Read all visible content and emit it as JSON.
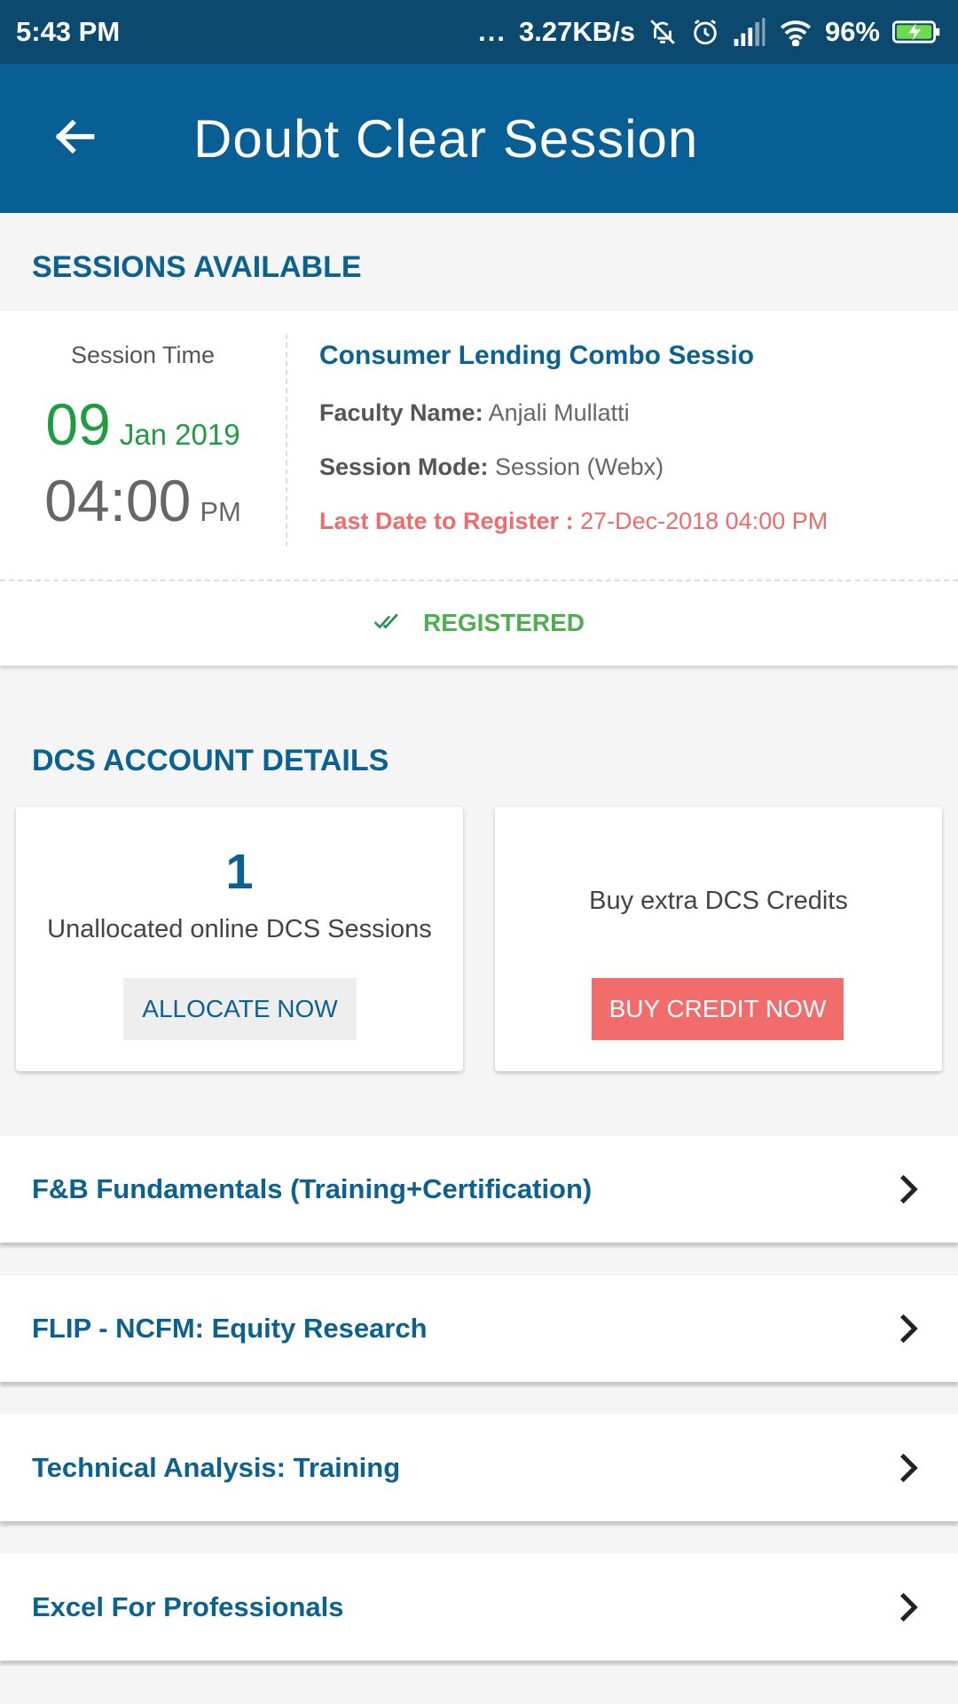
{
  "status_bar": {
    "time": "5:43 PM",
    "dots": "...",
    "speed": "3.27KB/s",
    "battery": "96%",
    "icons": [
      "bell-off-icon",
      "alarm-icon",
      "signal-icon",
      "wifi-icon",
      "battery-charging-icon"
    ]
  },
  "app_bar": {
    "title": "Doubt Clear Session",
    "back_icon": "arrow-left-icon"
  },
  "sessions": {
    "header": "SESSIONS AVAILABLE",
    "card": {
      "time_label": "Session Time",
      "day": "09",
      "month_year": "Jan 2019",
      "time": "04:00",
      "ampm": "PM",
      "title": "Consumer Lending Combo Sessio",
      "faculty_label": "Faculty Name:",
      "faculty_value": "Anjali Mullatti",
      "mode_label": "Session Mode:",
      "mode_value": "Session (Webx)",
      "deadline_label": "Last Date to Register :",
      "deadline_value": "27-Dec-2018 04:00 PM",
      "status": "REGISTERED",
      "status_icon": "double-check-icon"
    }
  },
  "dcs": {
    "header": "DCS ACCOUNT DETAILS",
    "allocate_card": {
      "count": "1",
      "text": "Unallocated online DCS Sessions",
      "button": "ALLOCATE NOW"
    },
    "buy_card": {
      "text": "Buy extra DCS Credits",
      "button": "BUY CREDIT NOW"
    }
  },
  "courses": [
    {
      "name": "F&B Fundamentals (Training+Certification)"
    },
    {
      "name": "FLIP - NCFM: Equity Research"
    },
    {
      "name": "Technical Analysis: Training"
    },
    {
      "name": "Excel For Professionals"
    }
  ],
  "colors": {
    "status_bar": "#0b4a6e",
    "app_bar": "#075f96",
    "primary_text": "#0b6190",
    "date_green": "#1e9c3f",
    "registered_green": "#4caf50",
    "alert_red": "#f06b6b",
    "buy_button": "#f26c6c"
  }
}
